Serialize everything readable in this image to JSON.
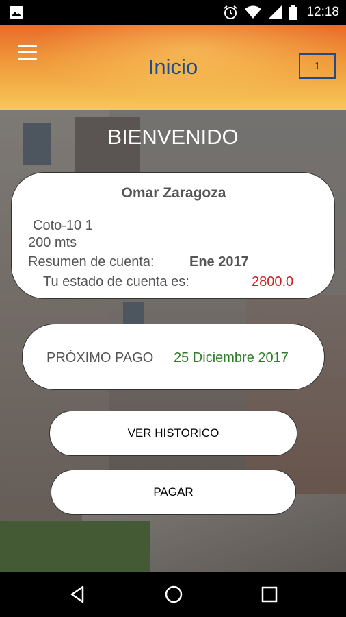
{
  "status_bar": {
    "time": "12:18",
    "icons": [
      "image-icon",
      "alarm-icon",
      "wifi-icon",
      "signal-icon",
      "battery-icon"
    ]
  },
  "app_bar": {
    "title": "Inicio",
    "badge": "1",
    "menu_icon": "hamburger-menu-icon"
  },
  "main": {
    "welcome": "BIENVENIDO",
    "account": {
      "name": "Omar Zaragoza",
      "unit": "Coto-10 1",
      "area": "200 mts",
      "summary_label": "Resumen de cuenta:",
      "summary_period": "Ene 2017",
      "status_label": "Tu estado de cuenta es:",
      "status_value": "2800.0"
    },
    "next_payment": {
      "label": "PRÓXIMO PAGO",
      "date": "25 Diciembre 2017"
    },
    "buttons": {
      "history": "VER HISTORICO",
      "pay": "PAGAR"
    }
  },
  "nav_bar": {
    "icons": [
      "back-icon",
      "home-icon",
      "recents-icon"
    ]
  },
  "colors": {
    "title_blue": "#1f4d8a",
    "amount_red": "#cc1f1f",
    "date_green": "#2f7d2c",
    "appbar_orange": "#f09a3a"
  }
}
